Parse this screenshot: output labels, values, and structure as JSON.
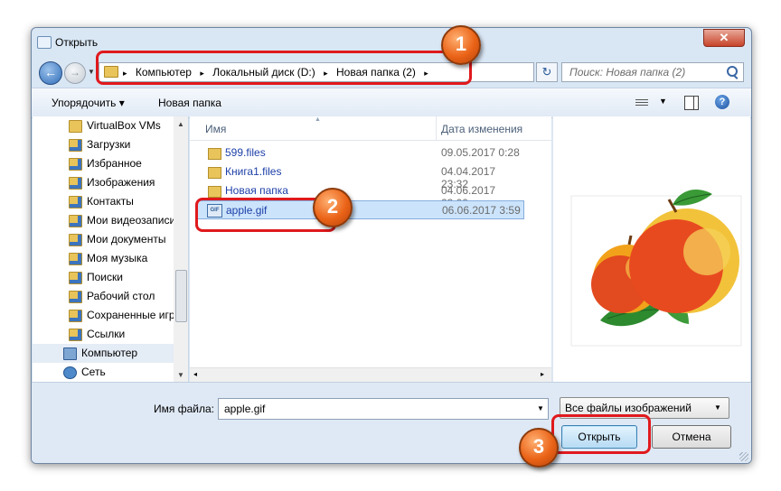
{
  "window": {
    "title": "Открыть",
    "close_glyph": "✕"
  },
  "nav": {
    "back_glyph": "←",
    "forward_glyph": "→",
    "history_dropdown_glyph": "▼"
  },
  "address": {
    "crumbs": [
      "Компьютер",
      "Локальный диск (D:)",
      "Новая папка (2)"
    ],
    "separator": "▸",
    "dropdown_glyph": "▼",
    "refresh_glyph": "↻"
  },
  "search": {
    "placeholder": "Поиск: Новая папка (2)",
    "icon": "search-icon"
  },
  "toolbar": {
    "organize_label": "Упорядочить ▾",
    "new_folder_label": "Новая папка",
    "views_dropdown_glyph": "▼",
    "help_glyph": "?"
  },
  "sidebar": {
    "items": [
      {
        "label": "VirtualBox VMs",
        "icon": "folder-icon"
      },
      {
        "label": "Загрузки",
        "icon": "downloads-folder-icon"
      },
      {
        "label": "Избранное",
        "icon": "favorites-folder-icon"
      },
      {
        "label": "Изображения",
        "icon": "pictures-folder-icon"
      },
      {
        "label": "Контакты",
        "icon": "contacts-folder-icon"
      },
      {
        "label": "Мои видеозаписи",
        "icon": "videos-folder-icon"
      },
      {
        "label": "Мои документы",
        "icon": "documents-folder-icon"
      },
      {
        "label": "Моя музыка",
        "icon": "music-folder-icon"
      },
      {
        "label": "Поиски",
        "icon": "searches-folder-icon"
      },
      {
        "label": "Рабочий стол",
        "icon": "desktop-folder-icon"
      },
      {
        "label": "Сохраненные игры",
        "icon": "saved-games-folder-icon"
      },
      {
        "label": "Ссылки",
        "icon": "links-folder-icon"
      },
      {
        "label": "Компьютер",
        "icon": "computer-icon"
      },
      {
        "label": "Сеть",
        "icon": "network-icon"
      }
    ],
    "selected": "Компьютер",
    "scroll_up_glyph": "▲",
    "scroll_down_glyph": "▼"
  },
  "file_list": {
    "columns": {
      "name": "Имя",
      "date": "Дата изменения"
    },
    "sort_glyph": "▲",
    "rows": [
      {
        "name": "599.files",
        "date": "09.05.2017 0:28",
        "icon": "folder-icon"
      },
      {
        "name": "Книга1.files",
        "date": "04.04.2017 23:32",
        "icon": "folder-icon"
      },
      {
        "name": "Новая папка",
        "date": "04.06.2017 23:09",
        "icon": "folder-icon"
      },
      {
        "name": "apple.gif",
        "date": "06.06.2017 3:59",
        "icon": "gif-file-icon",
        "icon_text": "GIF"
      }
    ],
    "selected": "apple.gif",
    "hscroll_left_glyph": "◂",
    "hscroll_right_glyph": "▸"
  },
  "preview": {
    "image": "apple-preview-image"
  },
  "bottom": {
    "filename_label": "Имя файла:",
    "filename_value": "apple.gif",
    "filename_dropdown_glyph": "▼",
    "filter_value": "Все файлы изображений",
    "filter_dropdown_glyph": "▼",
    "open_label": "Открыть",
    "cancel_label": "Отмена"
  },
  "annotations": {
    "badge_1": "1",
    "badge_2": "2",
    "badge_3": "3",
    "highlight_color": "#e0191d",
    "badge_color": "#ea6317"
  }
}
